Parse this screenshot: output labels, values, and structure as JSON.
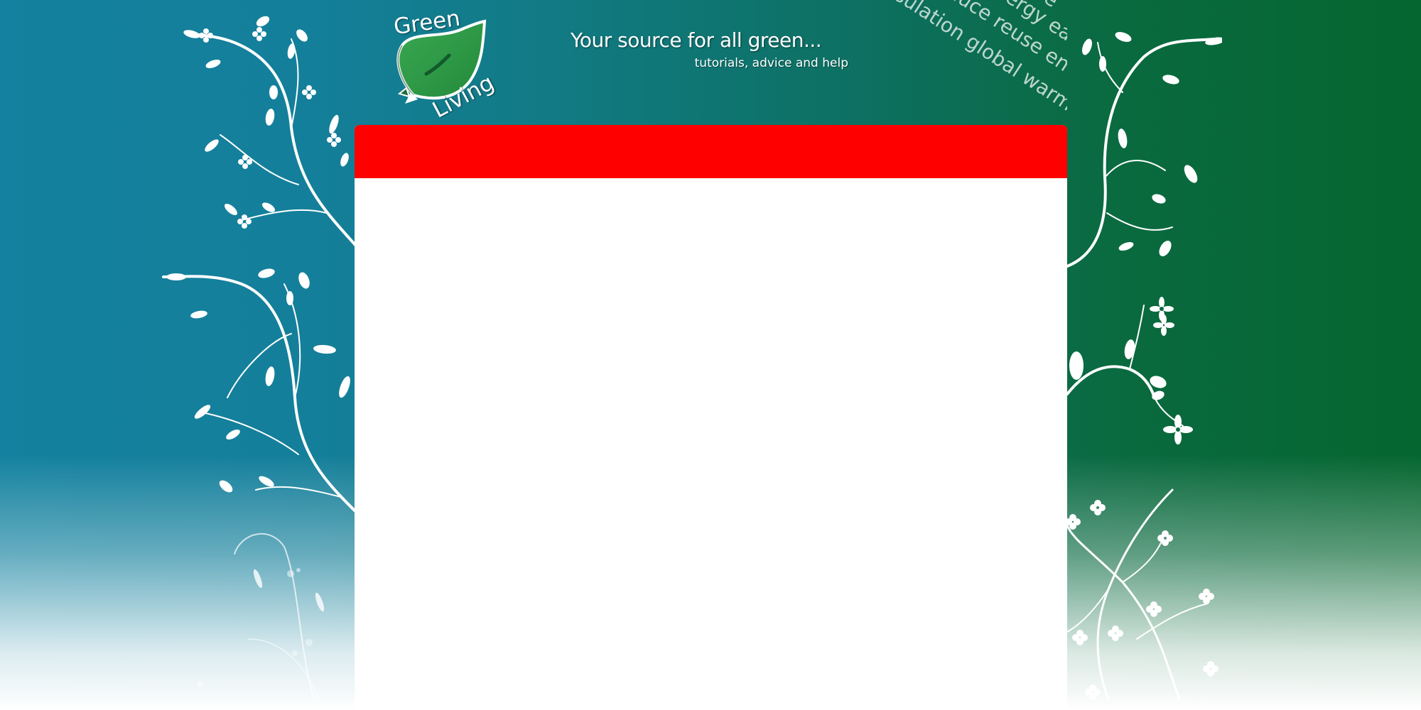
{
  "logo": {
    "word_top": "Green",
    "word_bottom": "Living",
    "icon": "leaf-icon",
    "leaf_color": "#2f9a45"
  },
  "header": {
    "tagline": "Your source for all green...",
    "subtagline": "tutorials, advice and help"
  },
  "word_cloud": {
    "lines": [
      "life",
      "energy ea",
      "reduce reuse environment",
      "insulation global warming recycle"
    ]
  },
  "content_panel": {
    "header_color": "#ff0000",
    "body_color": "#ffffff"
  },
  "background": {
    "left_color": "#13819f",
    "right_color": "#056630"
  }
}
